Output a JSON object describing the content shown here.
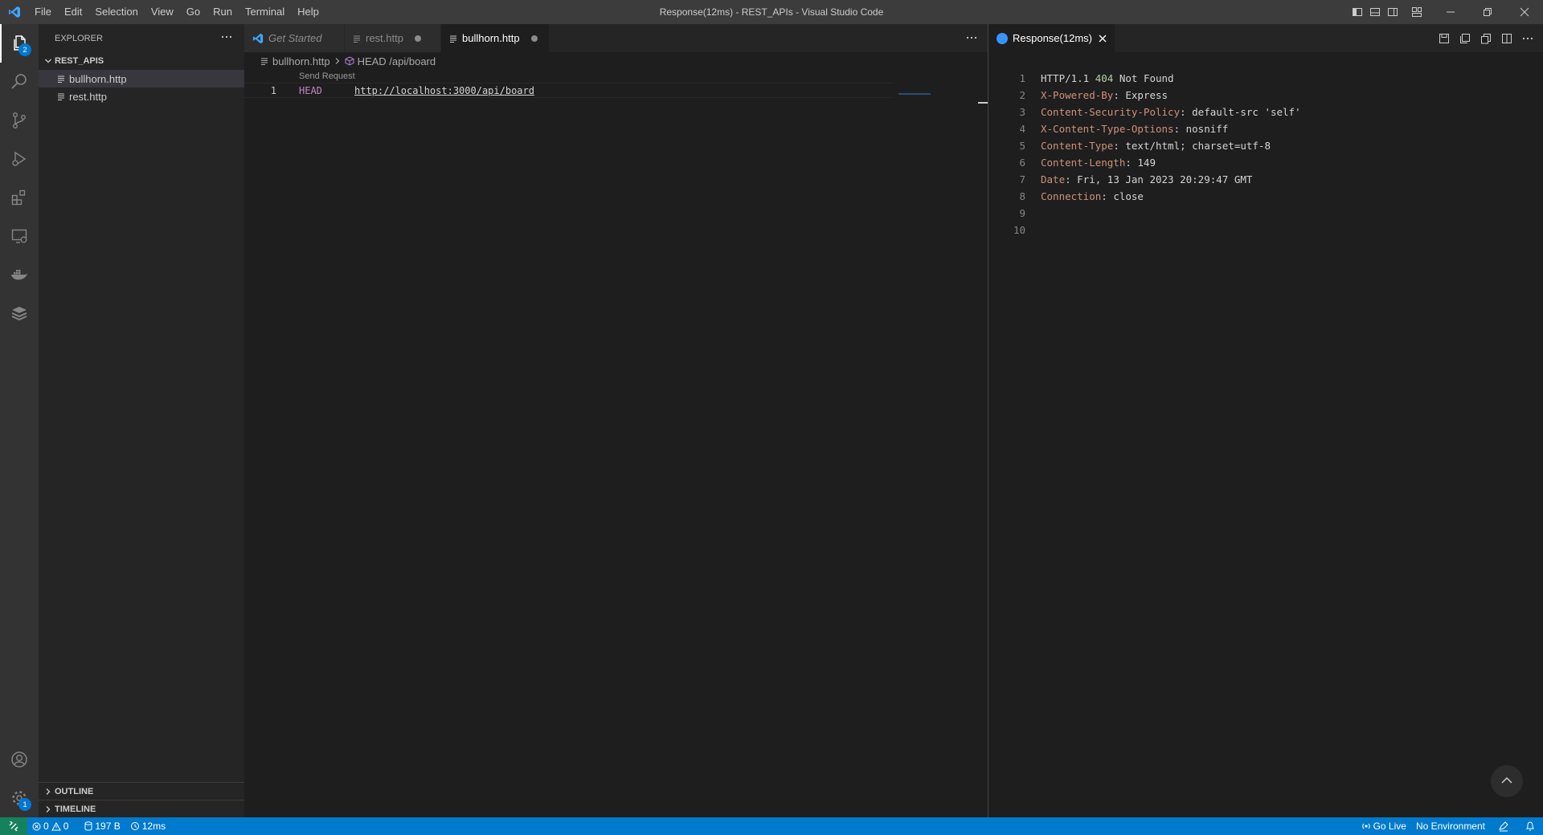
{
  "window_title": "Response(12ms) - REST_APIs - Visual Studio Code",
  "menu": [
    "File",
    "Edit",
    "Selection",
    "View",
    "Go",
    "Run",
    "Terminal",
    "Help"
  ],
  "activity": {
    "explorer_badge": "2",
    "settings_badge": "1"
  },
  "sidebar": {
    "title": "EXPLORER",
    "folder": "REST_APIS",
    "files": [
      "bullhorn.http",
      "rest.http"
    ],
    "outline": "OUTLINE",
    "timeline": "TIMELINE"
  },
  "editor": {
    "tabs": [
      "Get Started",
      "rest.http",
      "bullhorn.http"
    ],
    "breadcrumb_file": "bullhorn.http",
    "breadcrumb_symbol": "HEAD /api/board",
    "codelens": "Send Request",
    "line_number": "1",
    "method": "HEAD",
    "url": "http://localhost:3000/api/board"
  },
  "response": {
    "tab_label": "Response(12ms)",
    "lines": [
      {
        "n": "1",
        "name": "",
        "value": "",
        "status": [
          "HTTP/1.1 ",
          "404",
          " Not Found"
        ]
      },
      {
        "n": "2",
        "name": "X-Powered-By",
        "value": ": Express"
      },
      {
        "n": "3",
        "name": "Content-Security-Policy",
        "value": ": default-src 'self'"
      },
      {
        "n": "4",
        "name": "X-Content-Type-Options",
        "value": ": nosniff"
      },
      {
        "n": "5",
        "name": "Content-Type",
        "value": ": text/html; charset=utf-8"
      },
      {
        "n": "6",
        "name": "Content-Length",
        "value": ": 149"
      },
      {
        "n": "7",
        "name": "Date",
        "value": ": Fri, 13 Jan 2023 20:29:47 GMT"
      },
      {
        "n": "8",
        "name": "Connection",
        "value": ": close"
      },
      {
        "n": "9",
        "name": "",
        "value": ""
      },
      {
        "n": "10",
        "name": "",
        "value": ""
      }
    ]
  },
  "status": {
    "errors": "0",
    "warnings": "0",
    "size": "197 B",
    "time": "12ms",
    "go_live": "Go Live",
    "environment": "No Environment"
  },
  "colors": {
    "accent": "#007acc",
    "remote": "#16825d",
    "keyword": "#c586c0",
    "header_name": "#ce9178",
    "status_code": "#b5cea8"
  }
}
